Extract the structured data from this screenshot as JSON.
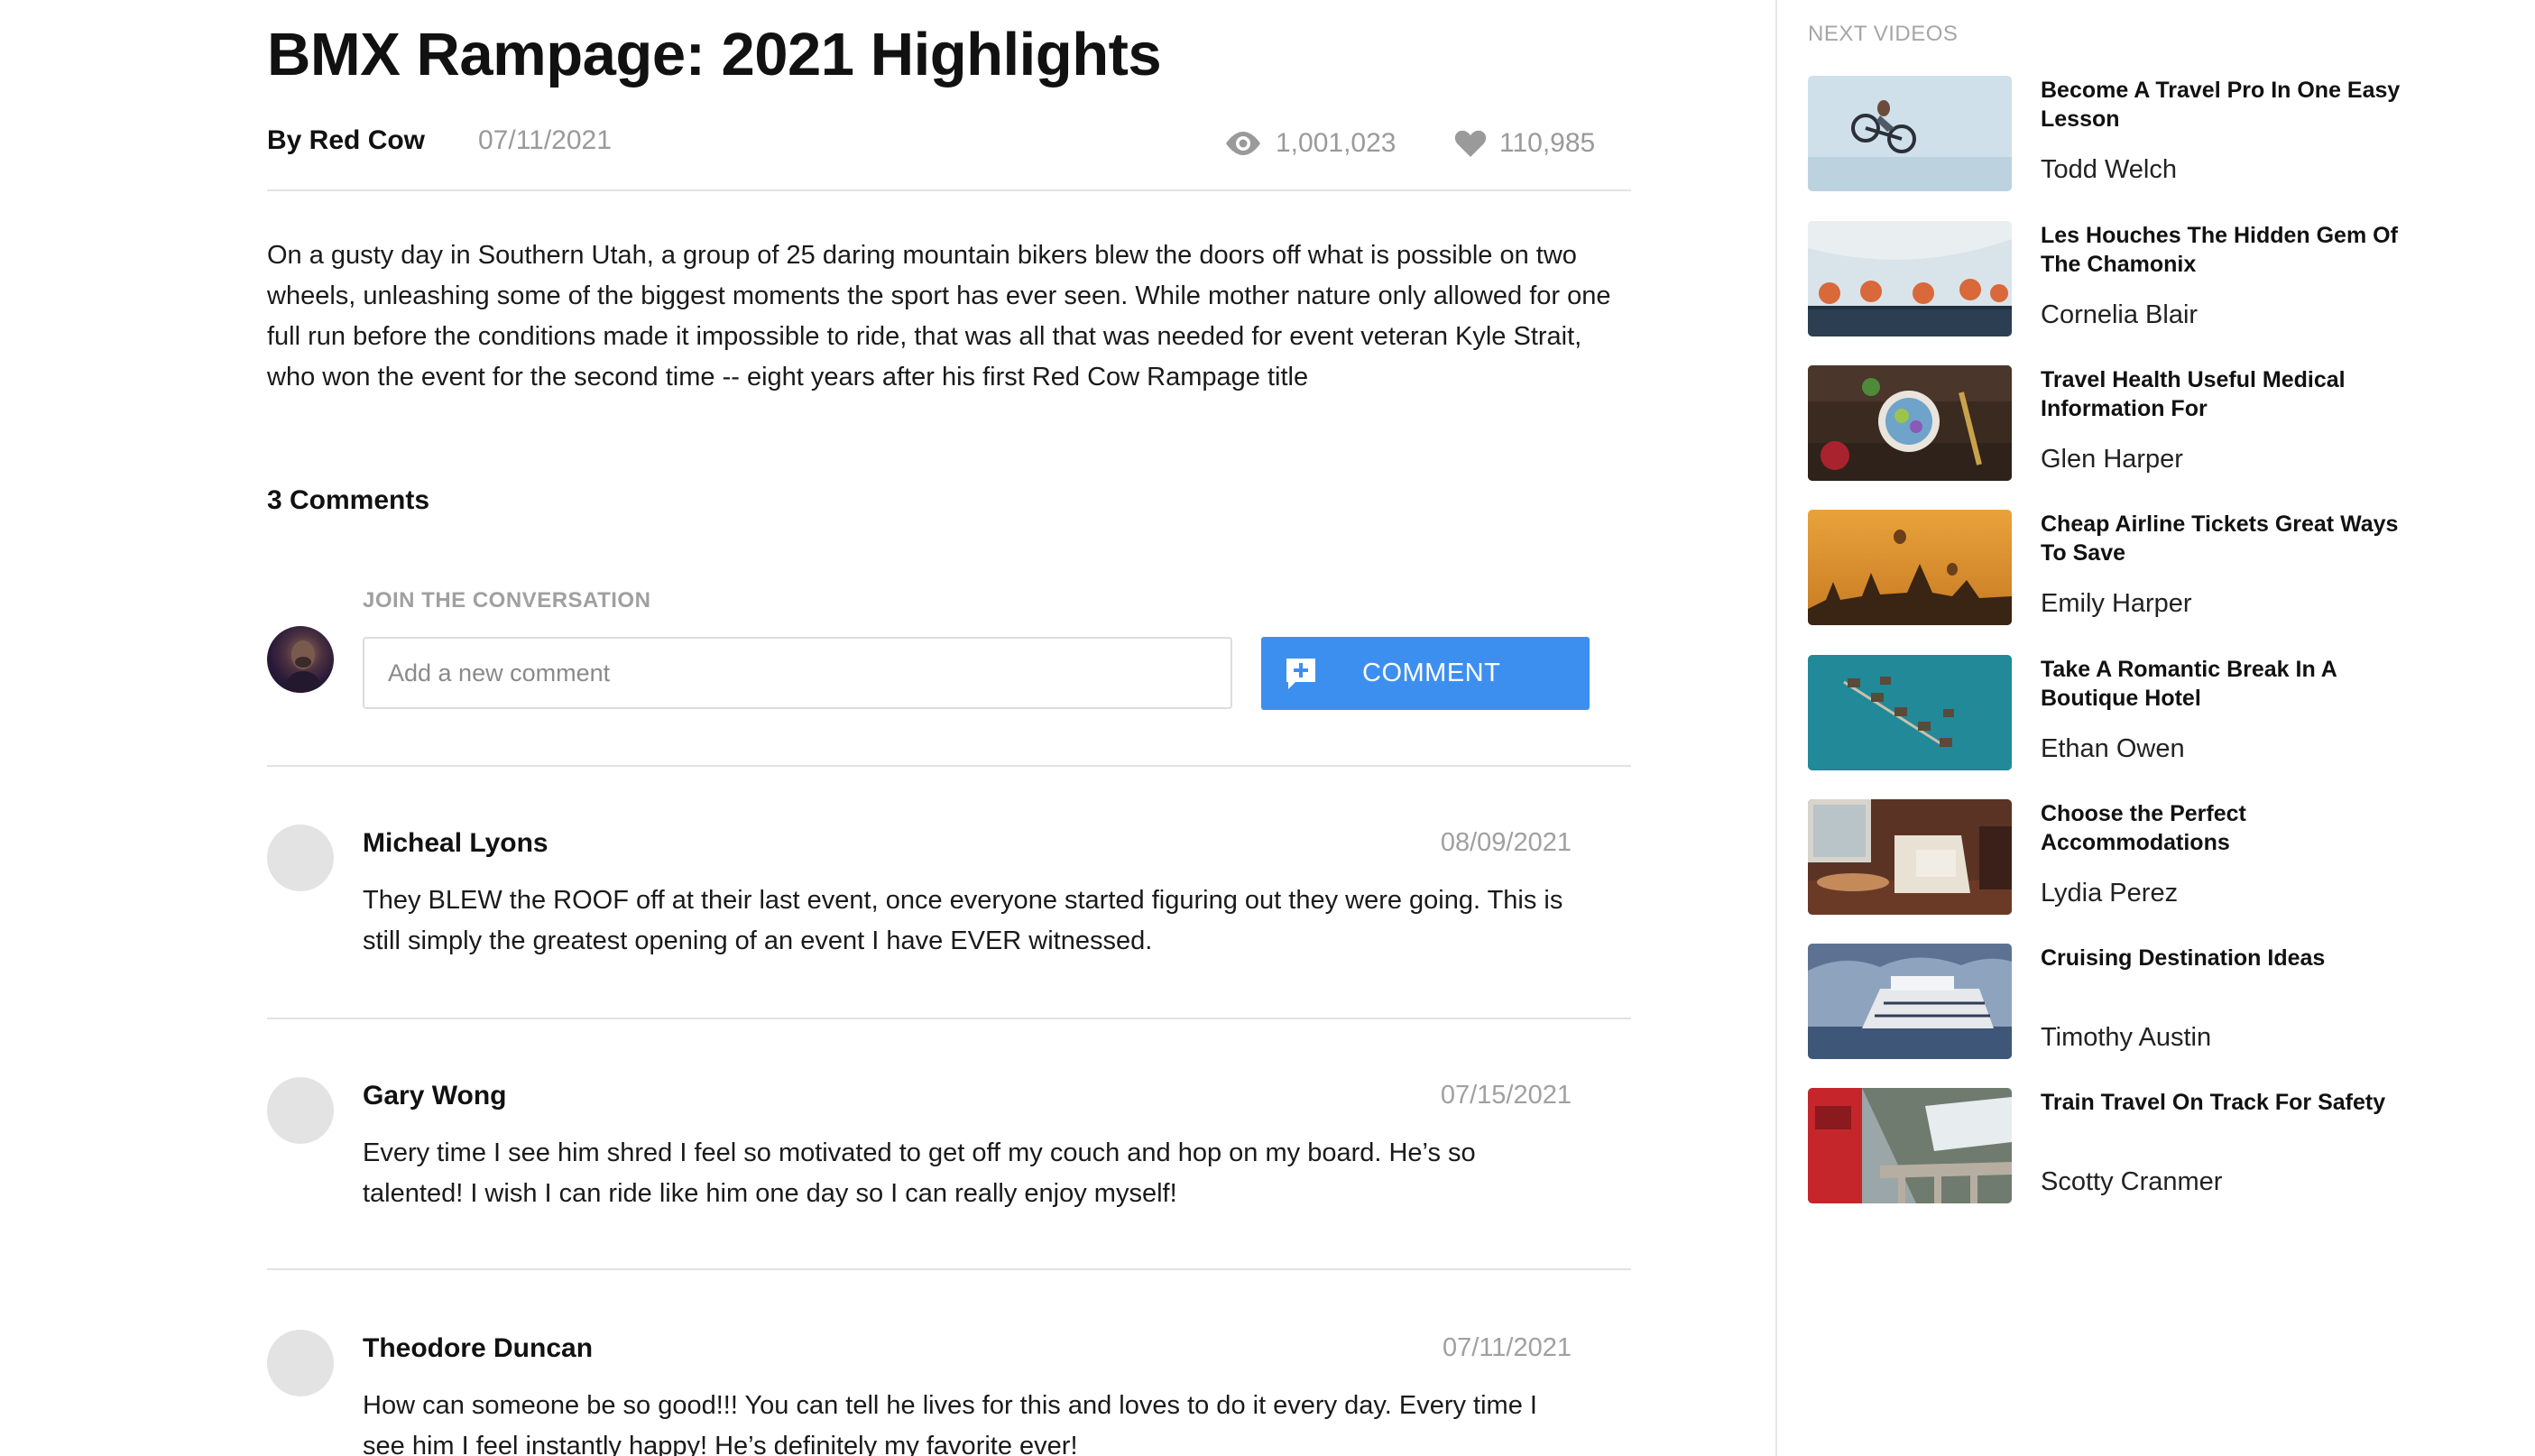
{
  "video": {
    "title": "BMX Rampage: 2021 Highlights",
    "author": "By Red Cow",
    "date": "07/11/2021",
    "views": "1,001,023",
    "likes": "110,985",
    "description": "On a gusty day in Southern Utah, a group of 25 daring mountain bikers blew the doors off what is possible on two wheels, unleashing some of the biggest moments the sport has ever seen. While mother nature only allowed for one full run before the conditions made it impossible to ride, that was all that was needed for event veteran Kyle Strait, who won the event for the second time -- eight years after his first Red Cow Rampage title"
  },
  "comments_section": {
    "heading": "3 Comments",
    "join_label": "JOIN THE CONVERSATION",
    "input_placeholder": "Add a new comment",
    "input_value": "",
    "button_label": "COMMENT",
    "button_color": "#3d8fef",
    "items": [
      {
        "name": "Micheal Lyons",
        "date": "08/09/2021",
        "text": "They BLEW the ROOF off at their last event, once everyone started figuring out they were going. This is still simply the greatest opening of an event I have EVER witnessed."
      },
      {
        "name": "Gary Wong",
        "date": "07/15/2021",
        "text": "Every time I see him shred I feel so motivated to get off my couch and hop on my board. He’s so talented! I wish I can ride like him one day so I can really enjoy myself!"
      },
      {
        "name": "Theodore Duncan",
        "date": "07/11/2021",
        "text": "How can someone be so good!!! You can tell he lives for this and loves to do it every day. Every time I see him I feel instantly happy! He’s definitely my favorite ever!"
      }
    ]
  },
  "sidebar": {
    "heading": "NEXT VIDEOS",
    "videos": [
      {
        "title": "Become A Travel Pro In One Easy Lesson",
        "creator": "Todd Welch"
      },
      {
        "title": "Les Houches The Hidden Gem Of The Chamonix",
        "creator": "Cornelia Blair"
      },
      {
        "title": "Travel Health Useful Medical Information For",
        "creator": "Glen Harper"
      },
      {
        "title": "Cheap Airline Tickets Great Ways To Save",
        "creator": "Emily Harper"
      },
      {
        "title": "Take A Romantic Break In A Boutique Hotel",
        "creator": "Ethan Owen"
      },
      {
        "title": "Choose the Perfect Accommodations",
        "creator": "Lydia Perez"
      },
      {
        "title": "Cruising Destination Ideas",
        "creator": "Timothy Austin"
      },
      {
        "title": "Train Travel On Track For Safety",
        "creator": "Scotty Cranmer"
      }
    ]
  },
  "icons": {
    "views": "eye-icon",
    "likes": "heart-icon",
    "comment_button": "add-comment-icon"
  }
}
